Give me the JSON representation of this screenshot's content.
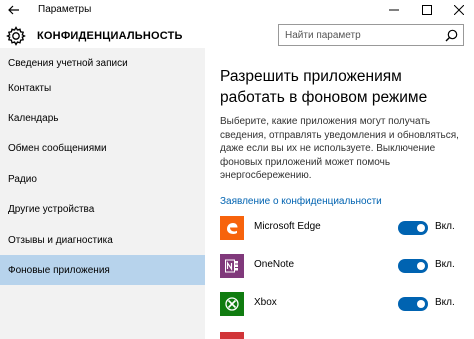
{
  "window": {
    "title": "Параметры"
  },
  "header": {
    "section_title": "КОНФИДЕНЦИАЛЬНОСТЬ",
    "search_placeholder": "Найти параметр"
  },
  "sidebar": {
    "items": [
      {
        "label": "Сведения учетной записи"
      },
      {
        "label": "Контакты"
      },
      {
        "label": "Календарь"
      },
      {
        "label": "Обмен сообщениями"
      },
      {
        "label": "Радио"
      },
      {
        "label": "Другие устройства"
      },
      {
        "label": "Отзывы и диагностика"
      },
      {
        "label": "Фоновые приложения",
        "active": true
      }
    ]
  },
  "main": {
    "title": "Разрешить приложениям работать в фоновом режиме",
    "description": "Выберите, какие приложения могут получать сведения, отправлять уведомления и обновляться, даже если вы их не используете. Выключение фоновых приложений может помочь энергосбережению.",
    "privacy_link": "Заявление о конфиденциальности",
    "apps": [
      {
        "name": "Microsoft Edge",
        "state": "Вкл.",
        "icon": "edge-icon",
        "color": "#f7630c",
        "enabled": true
      },
      {
        "name": "OneNote",
        "state": "Вкл.",
        "icon": "onenote-icon",
        "color": "#80397b",
        "enabled": true
      },
      {
        "name": "Xbox",
        "state": "Вкл.",
        "icon": "xbox-icon",
        "color": "#107c10",
        "enabled": true
      }
    ]
  },
  "colors": {
    "accent": "#0063b1",
    "sidebar_bg": "#f2f2f2",
    "active_item_bg": "#b7d3ec"
  }
}
